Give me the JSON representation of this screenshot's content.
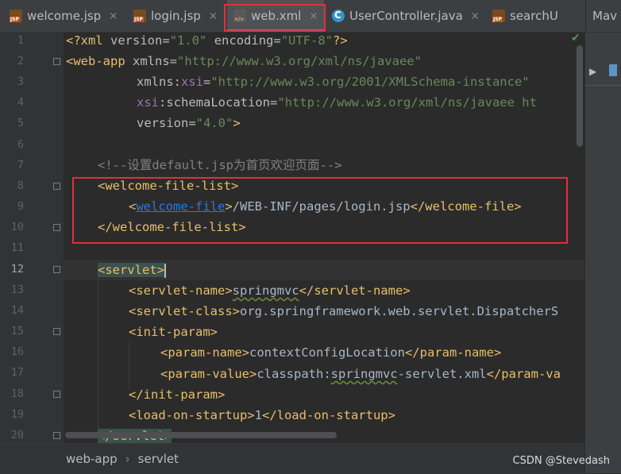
{
  "tabs": [
    {
      "label": "welcome.jsp",
      "icon": "jsp-file-icon",
      "close": "×"
    },
    {
      "label": "login.jsp",
      "icon": "jsp-file-icon",
      "close": "×"
    },
    {
      "label": "web.xml",
      "icon": "xml-file-icon",
      "close": "×",
      "active": true
    },
    {
      "label": "UserController.java",
      "icon": "java-class-icon",
      "close": "×"
    },
    {
      "label": "searchU",
      "icon": "jsp-file-icon"
    },
    {
      "label": "Mav"
    }
  ],
  "gutter": {
    "line_numbers": [
      "1",
      "2",
      "3",
      "4",
      "5",
      "6",
      "7",
      "8",
      "9",
      "10",
      "11",
      "12",
      "13",
      "14",
      "15",
      "16",
      "17",
      "18",
      "19",
      "20"
    ],
    "current_line": "12"
  },
  "code": {
    "l1": {
      "decl": "<?xml",
      "v": "version",
      "eq": "=",
      "vs": "\"1.0\"",
      "e": "encoding",
      "es": "\"UTF-8\"",
      "end": "?>"
    },
    "l2": {
      "tag": "<web-app",
      "attr": "xmlns",
      "eq": "=",
      "val": "\"http://www.w3.org/xml/ns/javaee\""
    },
    "l3": {
      "attr": "xmlns:",
      "ns": "xsi",
      "eq": "=",
      "val": "\"http://www.w3.org/2001/XMLSchema-instance\""
    },
    "l4": {
      "ns": "xsi",
      "attr": ":schemaLocation",
      "eq": "=",
      "val": "\"http://www.w3.org/xml/ns/javaee ht"
    },
    "l5": {
      "attr": "version",
      "eq": "=",
      "val": "\"4.0\"",
      "end": ">"
    },
    "l7": {
      "comment": "<!--设置default.jsp为首页欢迎页面-->"
    },
    "l8": {
      "tag": "<welcome-file-list>"
    },
    "l9": {
      "open": "<",
      "name": "welcome-file",
      "close_open": ">",
      "text": "/WEB-INF/pages/login.jsp",
      "close_tag": "</welcome-file>"
    },
    "l10": {
      "tag": "</welcome-file-list>"
    },
    "l12": {
      "tag": "<servlet>"
    },
    "l13": {
      "open": "<servlet-name>",
      "text": "springmvc",
      "close": "</servlet-name>"
    },
    "l14": {
      "open": "<servlet-class>",
      "text": "org.springframework.web.servlet.DispatcherS"
    },
    "l15": {
      "open": "<init-param>"
    },
    "l16": {
      "open": "<param-name>",
      "text": "contextConfigLocation",
      "close": "</param-name>"
    },
    "l17": {
      "open": "<param-value>",
      "text1": "classpath:",
      "text2": "springmvc",
      "text3": "-servlet.xml",
      "close": "</param-va"
    },
    "l18": {
      "open": "</init-param>"
    },
    "l19": {
      "open": "<load-on-startup>",
      "text": "1",
      "close": "</load-on-startup>"
    },
    "l20": {
      "open": "</servlet>"
    }
  },
  "breadcrumb": {
    "items": [
      "web-app",
      "servlet"
    ],
    "separator": "›"
  },
  "watermark": "CSDN @Stevedash",
  "colors": {
    "tag": "#e8bf6a",
    "string": "#6a8759",
    "namespace": "#9876aa",
    "comment": "#808080",
    "highlight": "#e0303a"
  }
}
